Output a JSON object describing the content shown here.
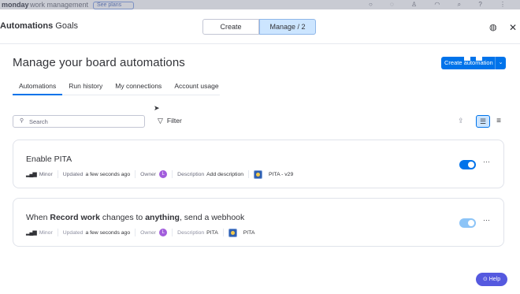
{
  "background": {
    "brand": "monday",
    "brand_sub": "work management",
    "pill_label": "See plans"
  },
  "topbar": {
    "title_bold": "Automations",
    "title_rest": "Goals",
    "tabs": [
      {
        "label": "Create"
      },
      {
        "label": "Manage / 2"
      }
    ],
    "feedback_icon": "feedback-icon",
    "close_icon": "close-icon"
  },
  "page": {
    "heading": "Manage your board automations",
    "create_button": "Create automation"
  },
  "tabs": [
    {
      "label": "Automations",
      "active": true
    },
    {
      "label": "Run history",
      "active": false
    },
    {
      "label": "My connections",
      "active": false
    },
    {
      "label": "Account usage",
      "active": false
    }
  ],
  "search": {
    "placeholder": "Search"
  },
  "filter": {
    "label": "Filter"
  },
  "automations": [
    {
      "title": "Enable PITA",
      "impact": "Minor",
      "updated_label": "Updated",
      "updated_value": "a few seconds ago",
      "owner_label": "Owner",
      "owner_initial": "L",
      "description_label": "Description",
      "description_value": "Add description",
      "board": "PITA - v29",
      "enabled": true
    },
    {
      "title_parts": [
        "When ",
        "Record work",
        " changes to ",
        "anything",
        ", send a webhook"
      ],
      "impact": "Minor",
      "updated_label": "Updated",
      "updated_value": "a few seconds ago",
      "owner_label": "Owner",
      "owner_initial": "L",
      "description_label": "Description",
      "description_value": "PITA",
      "board": "PITA",
      "enabled": true
    }
  ],
  "help": {
    "label": "Help"
  },
  "colors": {
    "primary": "#0073ea",
    "selected_bg": "#cce5ff",
    "owner_avatar": "#a25ddc",
    "help_button": "#5559df"
  }
}
